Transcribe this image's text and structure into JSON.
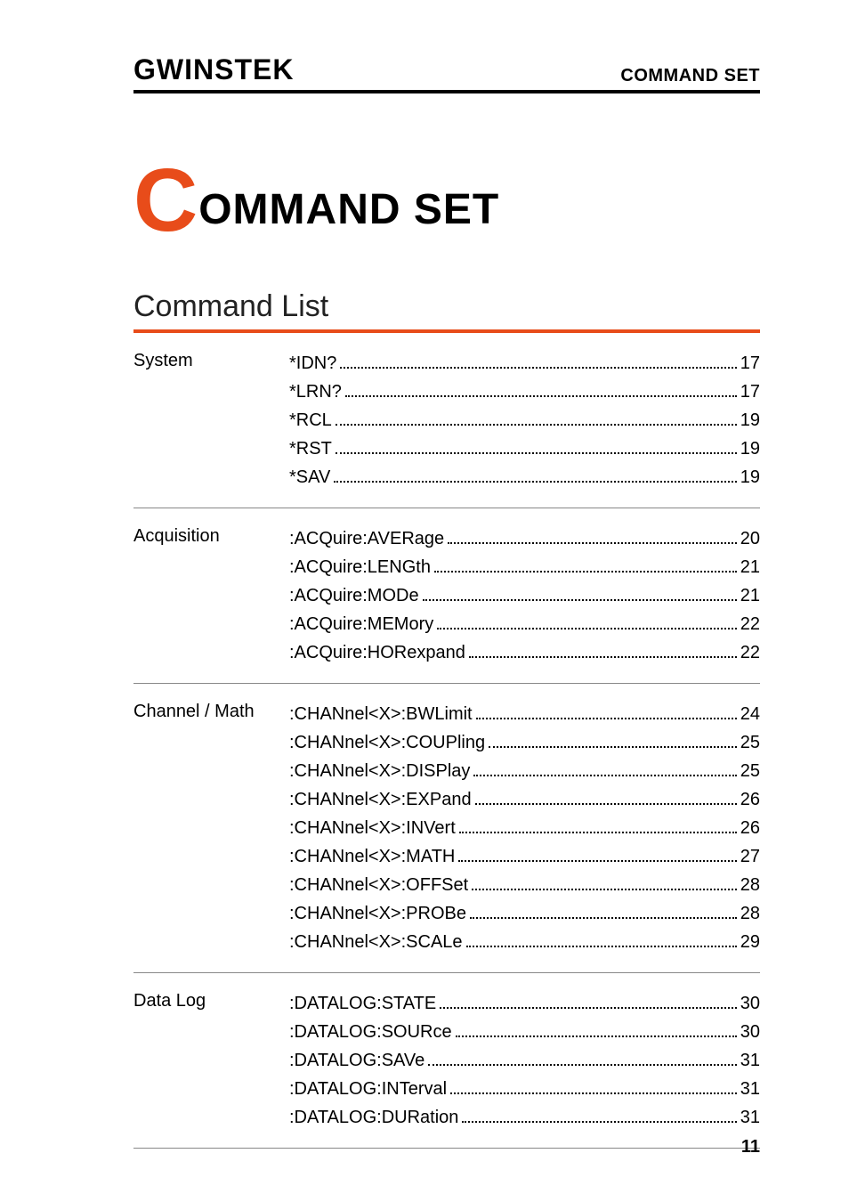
{
  "header": {
    "logo_text": "GWINSTEK",
    "right_title": "COMMAND SET"
  },
  "chapter": {
    "initial": "C",
    "rest": "OMMAND SET"
  },
  "section_title": "Command List",
  "groups": [
    {
      "label": "System",
      "entries": [
        {
          "cmd": "*IDN?",
          "page": "17"
        },
        {
          "cmd": "*LRN?",
          "page": "17"
        },
        {
          "cmd": "*RCL",
          "page": "19"
        },
        {
          "cmd": "*RST",
          "page": "19"
        },
        {
          "cmd": "*SAV",
          "page": "19"
        }
      ]
    },
    {
      "label": "Acquisition",
      "entries": [
        {
          "cmd": ":ACQuire:AVERage",
          "page": "20"
        },
        {
          "cmd": ":ACQuire:LENGth",
          "page": "21"
        },
        {
          "cmd": ":ACQuire:MODe",
          "page": "21"
        },
        {
          "cmd": ":ACQuire:MEMory",
          "page": "22"
        },
        {
          "cmd": ":ACQuire:HORexpand",
          "page": "22"
        }
      ]
    },
    {
      "label": "Channel / Math",
      "entries": [
        {
          "cmd": ":CHANnel<X>:BWLimit",
          "page": "24"
        },
        {
          "cmd": ":CHANnel<X>:COUPling",
          "page": "25"
        },
        {
          "cmd": ":CHANnel<X>:DISPlay",
          "page": "25"
        },
        {
          "cmd": ":CHANnel<X>:EXPand",
          "page": "26"
        },
        {
          "cmd": ":CHANnel<X>:INVert",
          "page": "26"
        },
        {
          "cmd": ":CHANnel<X>:MATH",
          "page": "27"
        },
        {
          "cmd": ":CHANnel<X>:OFFSet",
          "page": "28"
        },
        {
          "cmd": ":CHANnel<X>:PROBe",
          "page": "28"
        },
        {
          "cmd": ":CHANnel<X>:SCALe",
          "page": "29"
        }
      ]
    },
    {
      "label": "Data Log",
      "entries": [
        {
          "cmd": ":DATALOG:STATE",
          "page": "30"
        },
        {
          "cmd": ":DATALOG:SOURce",
          "page": "30"
        },
        {
          "cmd": ":DATALOG:SAVe",
          "page": "31"
        },
        {
          "cmd": ":DATALOG:INTerval",
          "page": "31"
        },
        {
          "cmd": ":DATALOG:DURation",
          "page": "31"
        }
      ]
    }
  ],
  "page_number": "11"
}
